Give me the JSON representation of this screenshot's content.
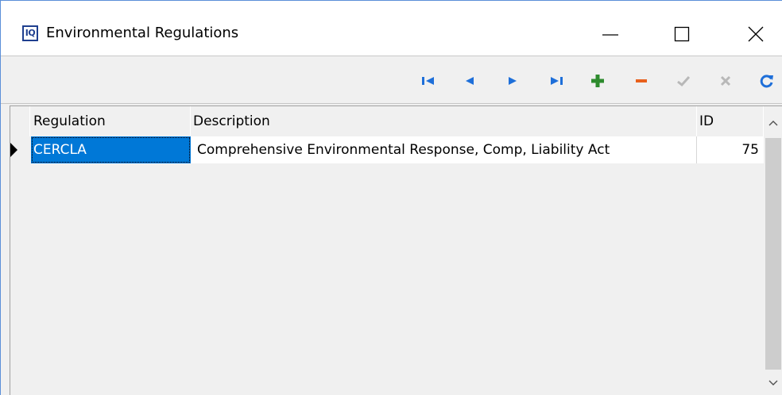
{
  "window": {
    "title": "Environmental Regulations",
    "app_icon_text": "IQ",
    "controls": [
      "minimize-icon",
      "maximize-icon",
      "close-icon"
    ]
  },
  "toolbar": {
    "buttons": [
      {
        "name": "first-record",
        "icon": "first-record-icon",
        "color": "#1e6fd9"
      },
      {
        "name": "prior-record",
        "icon": "prior-record-icon",
        "color": "#1e6fd9"
      },
      {
        "name": "next-record",
        "icon": "next-record-icon",
        "color": "#1e6fd9"
      },
      {
        "name": "last-record",
        "icon": "last-record-icon",
        "color": "#1e6fd9"
      },
      {
        "name": "insert-record",
        "icon": "plus-icon",
        "color": "#2e8b2e"
      },
      {
        "name": "delete-record",
        "icon": "minus-icon",
        "color": "#e8601c"
      },
      {
        "name": "post-edit",
        "icon": "check-icon",
        "color": "#b8b8b8"
      },
      {
        "name": "cancel-edit",
        "icon": "x-icon",
        "color": "#b8b8b8"
      },
      {
        "name": "refresh-data",
        "icon": "refresh-icon",
        "color": "#1e6fd9"
      }
    ]
  },
  "grid": {
    "columns": [
      "Regulation",
      "Description",
      "ID"
    ],
    "rows": [
      {
        "regulation": "CERCLA",
        "description": "Comprehensive Environmental Response, Comp, Liability Act",
        "id": "75",
        "current": true,
        "selected_column": "Regulation"
      }
    ],
    "selection_color": "#0078d7"
  },
  "scrollbar": {
    "up_icon": "chevron-up-icon",
    "down_icon": "chevron-down-icon"
  }
}
